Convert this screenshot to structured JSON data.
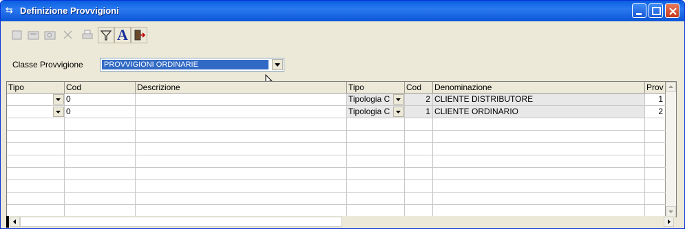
{
  "window": {
    "title": "Definizione Provvigioni",
    "title_icon": "arrows-icon"
  },
  "toolbar": {
    "items": [
      "new-doc-icon",
      "open-icon",
      "find-icon",
      "delete-icon",
      "print-icon",
      "filter-icon",
      "font-icon",
      "exit-door-icon"
    ],
    "font_glyph": "A"
  },
  "filter": {
    "label": "Classe Provvigione",
    "value": "PROVVIGIONI ORDINARIE"
  },
  "grid": {
    "headers": [
      "Tipo",
      "Cod",
      "Descrizione",
      "Tipo",
      "Cod",
      "Denominazione",
      "Prov"
    ],
    "rows": [
      {
        "tipo": "",
        "cod": "0",
        "descrizione": "",
        "tipo2": "Tipologia C",
        "cod2": "2",
        "denominazione": "CLIENTE DISTRIBUTORE",
        "prov": "1"
      },
      {
        "tipo": "",
        "cod": "0",
        "descrizione": "",
        "tipo2": "Tipologia C",
        "cod2": "1",
        "denominazione": "CLIENTE ORDINARIO",
        "prov": "2"
      }
    ]
  },
  "colors": {
    "title_bar": "#0a5fe0",
    "selection": "#316ac5",
    "frame": "#ece9d8"
  }
}
